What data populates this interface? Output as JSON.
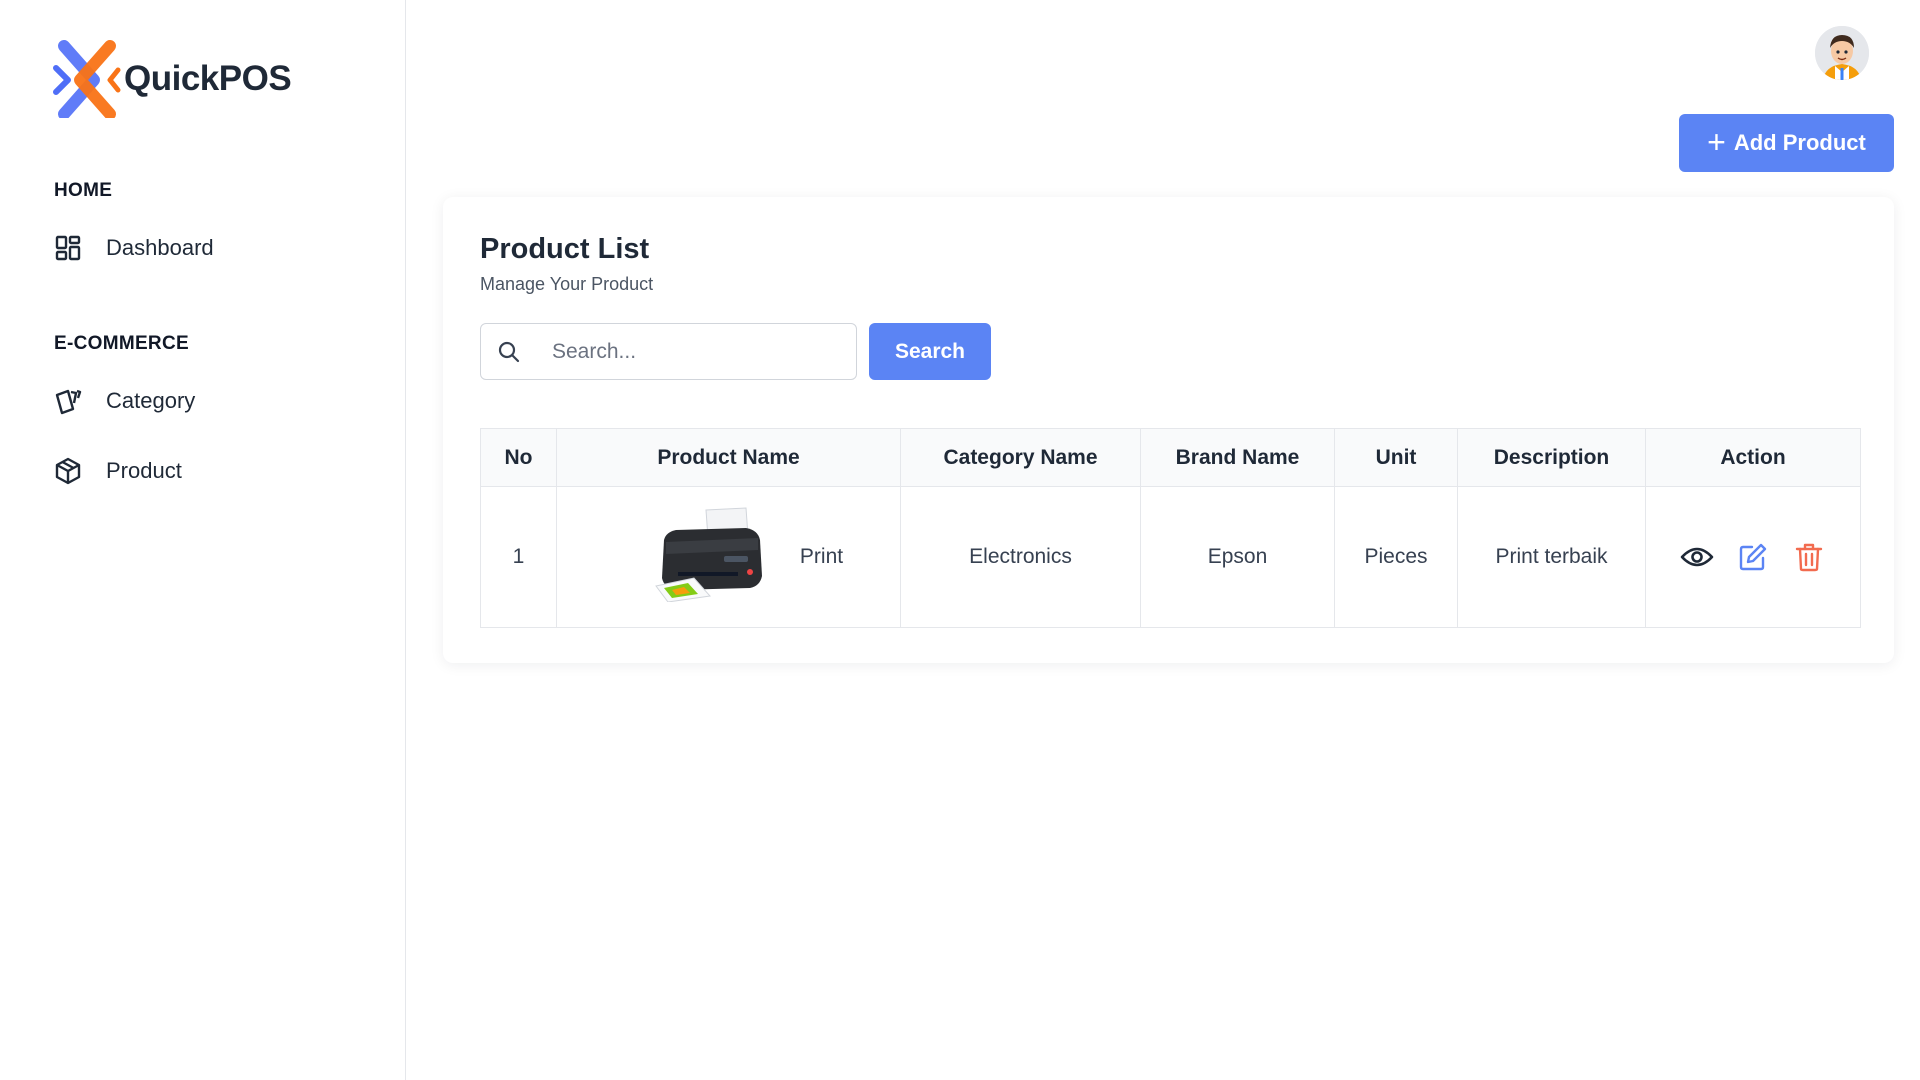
{
  "app": {
    "brand_name": "QuickPOS",
    "accent_color": "#5b84f4",
    "logo_colors": [
      "#4f6ef7",
      "#f97316"
    ]
  },
  "sidebar": {
    "sections": [
      {
        "title": "HOME",
        "items": [
          {
            "label": "Dashboard",
            "icon": "dashboard-icon"
          }
        ]
      },
      {
        "title": "E-COMMERCE",
        "items": [
          {
            "label": "Category",
            "icon": "category-icon"
          },
          {
            "label": "Product",
            "icon": "box-icon"
          }
        ]
      }
    ]
  },
  "header": {
    "avatar": "user-avatar",
    "add_button_label": "Add Product",
    "add_button_icon": "plus-icon"
  },
  "card": {
    "title": "Product List",
    "subtitle": "Manage Your Product",
    "search": {
      "placeholder": "Search...",
      "value": "",
      "button_label": "Search"
    }
  },
  "table": {
    "columns": [
      "No",
      "Product Name",
      "Category Name",
      "Brand Name",
      "Unit",
      "Description",
      "Action"
    ],
    "rows": [
      {
        "no": "1",
        "product_image": "printer-image",
        "product_name": "Print",
        "category": "Electronics",
        "brand": "Epson",
        "unit": "Pieces",
        "description": "Print terbaik",
        "actions": [
          "eye-icon",
          "edit-icon",
          "trash-icon"
        ]
      }
    ],
    "action_colors": {
      "view": "#1f2937",
      "edit": "#5b84f4",
      "delete": "#f26b4f"
    }
  }
}
